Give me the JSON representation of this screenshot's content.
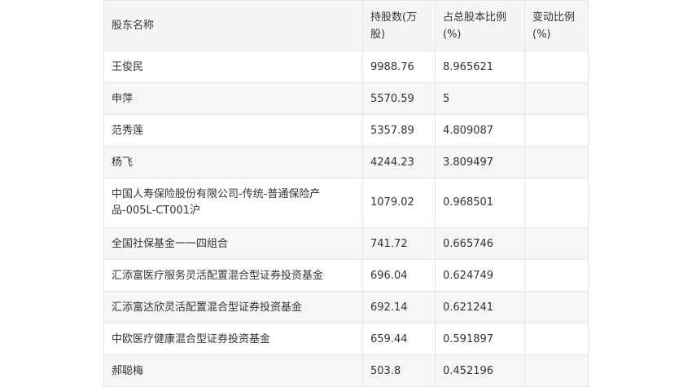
{
  "table": {
    "headers": [
      "股东名称",
      "持股数(万股)",
      "占总股本比例(%)",
      "变动比例(%)"
    ],
    "rows": [
      [
        "王俊民",
        "9988.76",
        "8.965621",
        ""
      ],
      [
        "申萍",
        "5570.59",
        "5",
        ""
      ],
      [
        "范秀莲",
        "5357.89",
        "4.809087",
        ""
      ],
      [
        "杨飞",
        "4244.23",
        "3.809497",
        ""
      ],
      [
        "中国人寿保险股份有限公司-传统-普通保险产品-005L-CT001沪",
        "1079.02",
        "0.968501",
        ""
      ],
      [
        "全国社保基金一一四组合",
        "741.72",
        "0.665746",
        ""
      ],
      [
        "汇添富医疗服务灵活配置混合型证券投资基金",
        "696.04",
        "0.624749",
        ""
      ],
      [
        "汇添富达欣灵活配置混合型证券投资基金",
        "692.14",
        "0.621241",
        ""
      ],
      [
        "中欧医疗健康混合型证券投资基金",
        "659.44",
        "0.591897",
        ""
      ],
      [
        "郝聪梅",
        "503.8",
        "0.452196",
        ""
      ]
    ]
  }
}
